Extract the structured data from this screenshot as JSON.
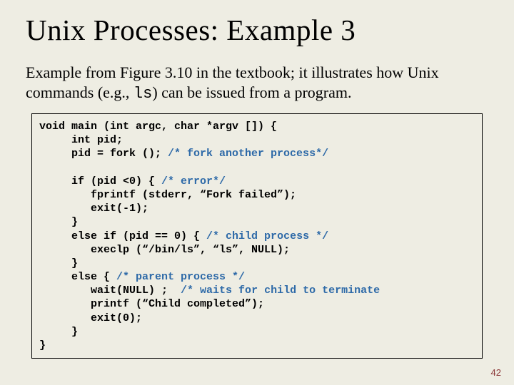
{
  "title": "Unix Processes: Example 3",
  "desc_before_mono": "Example from Figure 3.10 in the textbook; it illustrates how Unix commands (e.g., ",
  "desc_mono": "ls",
  "desc_after_mono": ") can be issued from a program.",
  "code": {
    "l01a": "void main (int argc, char *argv []) {",
    "l02a": "     int pid;",
    "l03a": "     pid = fork (); ",
    "l03c": "/* fork another process*/",
    "l04a": "",
    "l05a": "     if (pid <0) { ",
    "l05c": "/* error*/",
    "l06a": "        fprintf (stderr, “Fork failed”);",
    "l07a": "        exit(-1);",
    "l08a": "     }",
    "l09a": "     else if (pid == 0) { ",
    "l09c": "/* child process */",
    "l10a": "        execlp (“/bin/ls”, “ls”, NULL);",
    "l11a": "     }",
    "l12a": "     else { ",
    "l12c": "/* parent process */",
    "l13a": "        wait(NULL) ;  ",
    "l13c": "/* waits for child to terminate",
    "l14a": "        printf (“Child completed”);",
    "l15a": "        exit(0);",
    "l16a": "     }",
    "l17a": "}"
  },
  "page_number": "42"
}
